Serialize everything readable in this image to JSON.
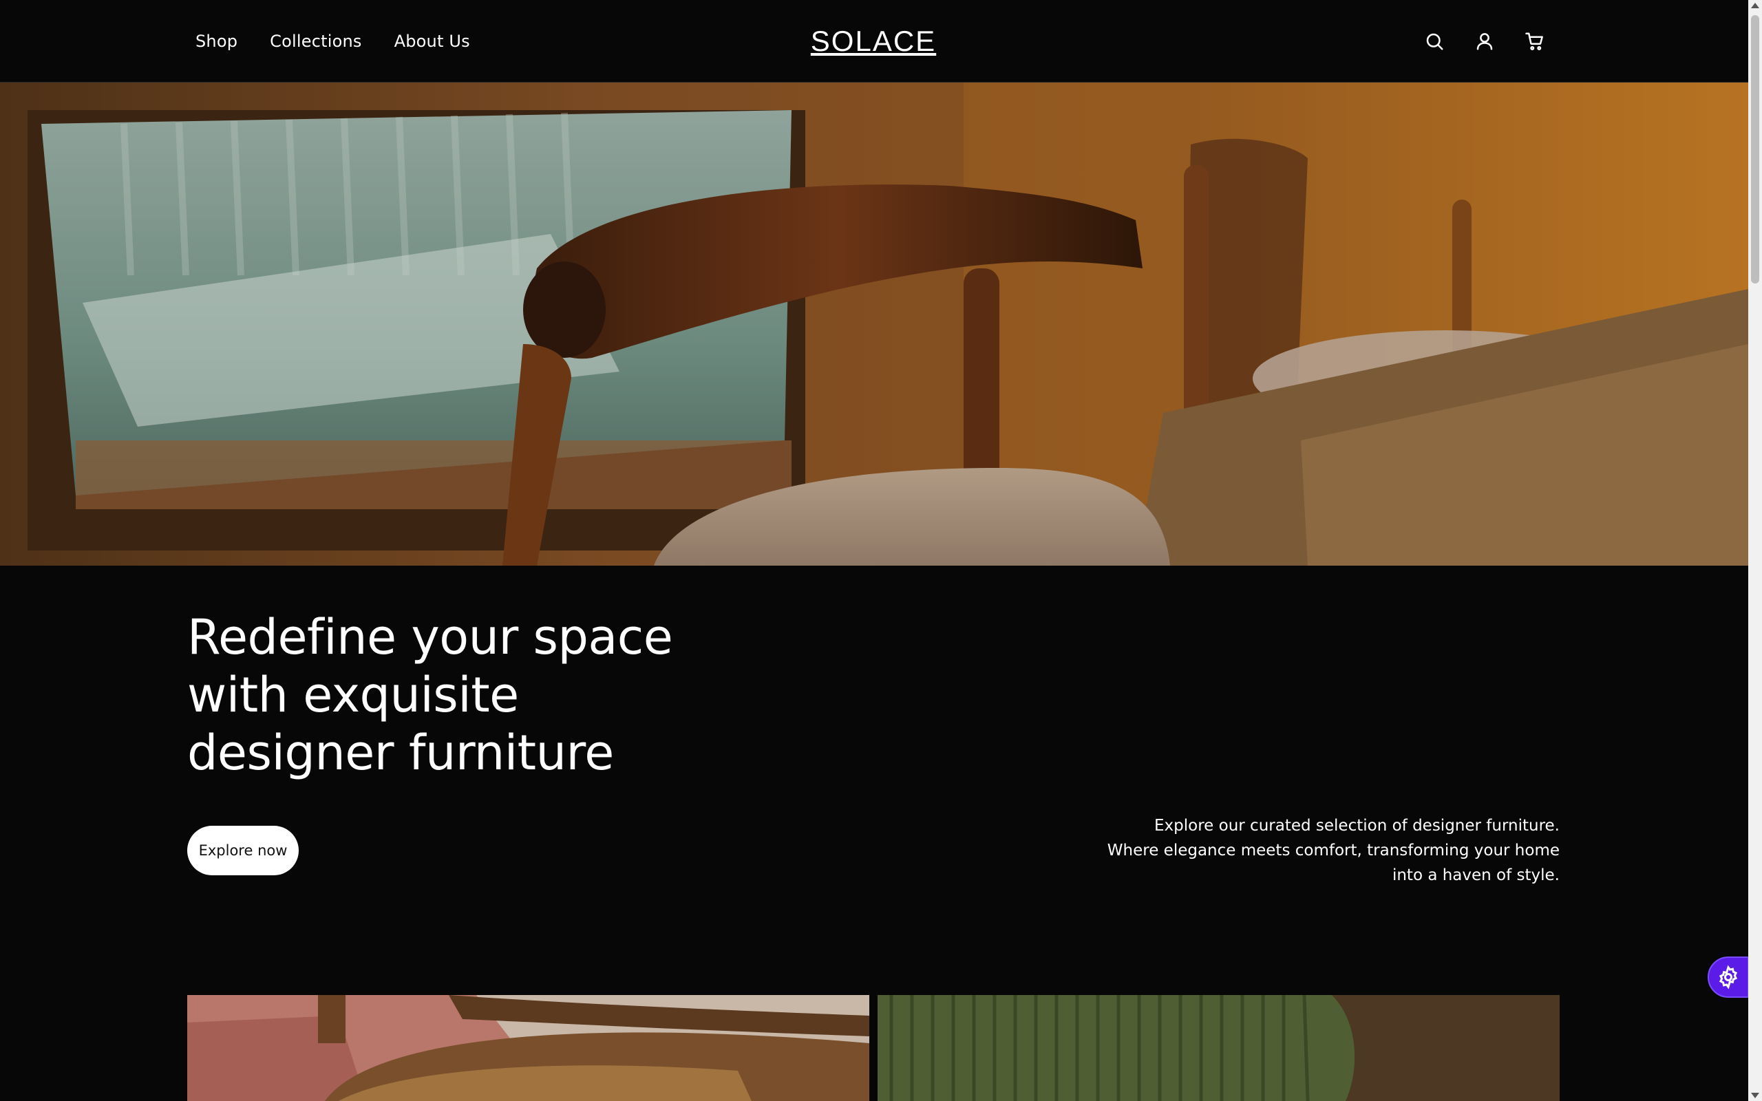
{
  "header": {
    "nav": [
      {
        "label": "Shop"
      },
      {
        "label": "Collections"
      },
      {
        "label": "About Us"
      }
    ],
    "logo": "SOLACE",
    "icons": [
      "search-icon",
      "account-icon",
      "cart-icon"
    ]
  },
  "hero": {
    "headline": "Redefine your space with exquisite designer furniture",
    "cta_label": "Explore now",
    "tagline": "Explore our curated selection of designer furniture. Where elegance meets comfort, transforming your home into a haven of style."
  },
  "colors": {
    "background": "#070707",
    "text": "#ffffff",
    "cta_bg": "#ffffff",
    "accent": "#5b1ce8"
  }
}
